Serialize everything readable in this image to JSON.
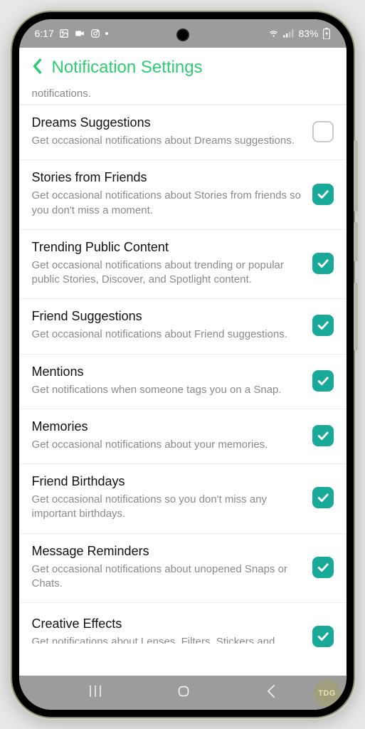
{
  "status": {
    "time": "6:17",
    "battery": "83%"
  },
  "header": {
    "title": "Notification Settings"
  },
  "partial_top_text": "notifications.",
  "settings": [
    {
      "title": "Dreams Suggestions",
      "desc": "Get occasional notifications about Dreams suggestions.",
      "checked": false
    },
    {
      "title": "Stories from Friends",
      "desc": "Get occasional notifications about Stories from friends so you don't miss a moment.",
      "checked": true
    },
    {
      "title": "Trending Public Content",
      "desc": "Get occasional notifications about trending or popular public Stories, Discover, and Spotlight content.",
      "checked": true
    },
    {
      "title": "Friend Suggestions",
      "desc": "Get occasional notifications about Friend suggestions.",
      "checked": true
    },
    {
      "title": "Mentions",
      "desc": "Get notifications when someone tags you on a Snap.",
      "checked": true
    },
    {
      "title": "Memories",
      "desc": "Get occasional notifications about your memories.",
      "checked": true
    },
    {
      "title": "Friend Birthdays",
      "desc": "Get occasional notifications so you don't miss any important birthdays.",
      "checked": true
    },
    {
      "title": "Message Reminders",
      "desc": "Get occasional notifications about unopened Snaps or Chats.",
      "checked": true
    },
    {
      "title": "Creative Effects",
      "desc": "Get notifications about Lenses, Filters, Stickers and",
      "checked": true
    }
  ],
  "brand": "TDG"
}
